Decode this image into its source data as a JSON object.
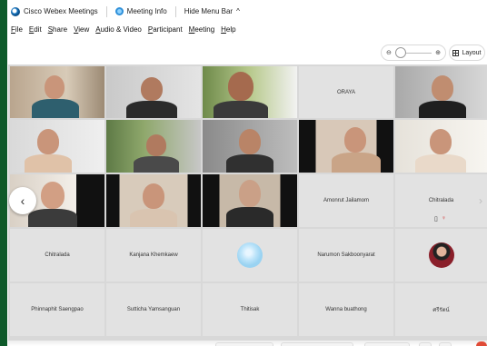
{
  "titlebar": {
    "app_title": "Cisco Webex Meetings",
    "meeting_info": "Meeting Info",
    "hide_menu_bar": "Hide Menu Bar",
    "hide_menu_chevron": "^"
  },
  "menu": [
    "File",
    "Edit",
    "Share",
    "View",
    "Audio & Video",
    "Participant",
    "Meeting",
    "Help"
  ],
  "toolbar": {
    "zoom_out": "⊖",
    "zoom_in": "⊕",
    "layout_label": "Layout"
  },
  "name_tiles": {
    "oraya": "ORAYA",
    "amonrut": "Amonrut Jailamom",
    "chitralada_1": "Chitralada",
    "chitralada_2": "Chitralada",
    "kanjana": "Kanjana Khemkaew",
    "narumon": "Narumon Sakboonyarat",
    "phinnaphit": "Phinnaphit Saengpao",
    "sutticha": "Sutticha Yamsanguan",
    "thitisak": "Thitisak",
    "wanna": "Wanna buathong",
    "thai_name": "ศรีรัตน์"
  },
  "nav": {
    "prev": "‹",
    "next": "›"
  },
  "colors": {
    "window_bg": "#ffffff",
    "desktop_green": "#0e5a2a",
    "tile_gray": "#e2e2e2",
    "end_red": "#e04b37"
  },
  "icons": [
    "webex-icon",
    "info-icon",
    "zoom-out-icon",
    "zoom-in-icon",
    "grid-icon",
    "phone-icon",
    "mute-icon"
  ]
}
